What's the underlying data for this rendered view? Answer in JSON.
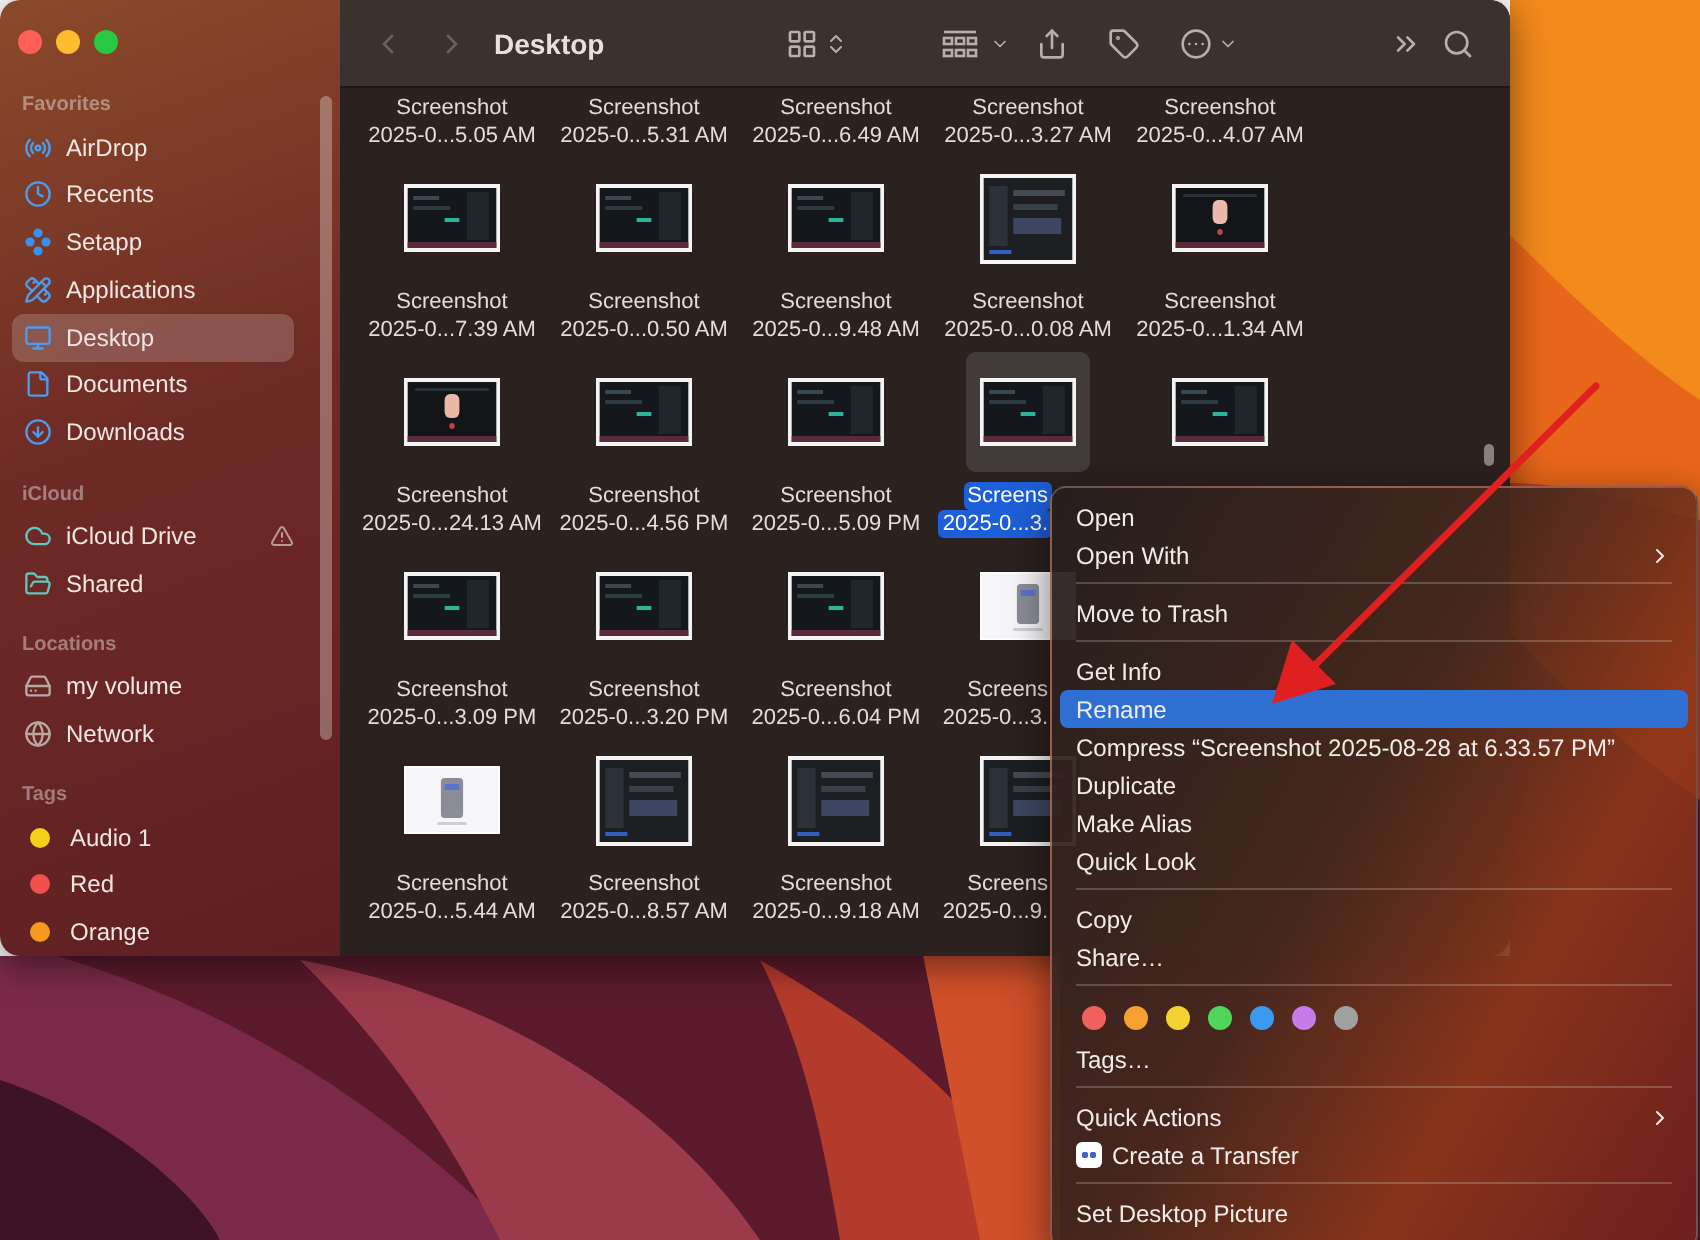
{
  "window": {
    "title": "Desktop"
  },
  "toolbar": {
    "back": {
      "disabled": true
    },
    "forward": {
      "disabled": true
    }
  },
  "sidebar": {
    "sections": [
      {
        "header": "Favorites",
        "items": [
          {
            "label": "AirDrop",
            "kind": "airdrop",
            "selected": false
          },
          {
            "label": "Recents",
            "kind": "clock",
            "selected": false
          },
          {
            "label": "Setapp",
            "kind": "setapp",
            "selected": false
          },
          {
            "label": "Applications",
            "kind": "apps",
            "selected": false
          },
          {
            "label": "Desktop",
            "kind": "desktop",
            "selected": true
          },
          {
            "label": "Documents",
            "kind": "document",
            "selected": false
          },
          {
            "label": "Downloads",
            "kind": "download",
            "selected": false
          }
        ]
      },
      {
        "header": "iCloud",
        "items": [
          {
            "label": "iCloud Drive",
            "kind": "cloud",
            "selected": false,
            "warning": true
          },
          {
            "label": "Shared",
            "kind": "shared",
            "selected": false,
            "warning": false
          }
        ]
      },
      {
        "header": "Locations",
        "items": [
          {
            "label": "my volume",
            "kind": "drive",
            "selected": false
          },
          {
            "label": "Network",
            "kind": "network",
            "selected": false
          }
        ]
      },
      {
        "header": "Tags",
        "items": [
          {
            "label": "Audio 1",
            "kind": "tag",
            "color": "#f5cf1a",
            "selected": false
          },
          {
            "label": "Red",
            "kind": "tag",
            "color": "#f0504c",
            "selected": false
          },
          {
            "label": "Orange",
            "kind": "tag",
            "color": "#f59a1e",
            "selected": false
          }
        ]
      }
    ]
  },
  "files": {
    "rows": [
      {
        "items": [
          {
            "label": [
              "Screenshot",
              "2025-0...5.05 AM"
            ],
            "selected": false
          },
          {
            "label": [
              "Screenshot",
              "2025-0...5.31 AM"
            ],
            "selected": false
          },
          {
            "label": [
              "Screenshot",
              "2025-0...6.49 AM"
            ],
            "selected": false
          },
          {
            "label": [
              "Screenshot",
              "2025-0...3.27 AM"
            ],
            "selected": false
          },
          {
            "label": [
              "Screenshot",
              "2025-0...4.07 AM"
            ],
            "selected": false
          }
        ]
      },
      {
        "items": [
          {
            "kind": "dark",
            "label": [
              "Screenshot",
              "2025-0...7.39 AM"
            ],
            "selected": false
          },
          {
            "kind": "dark",
            "label": [
              "Screenshot",
              "2025-0...0.50 AM"
            ],
            "selected": false
          },
          {
            "kind": "dark",
            "label": [
              "Screenshot",
              "2025-0...9.48 AM"
            ],
            "selected": false
          },
          {
            "kind": "tall",
            "label": [
              "Screenshot",
              "2025-0...0.08 AM"
            ],
            "selected": false
          },
          {
            "kind": "figure",
            "label": [
              "Screenshot",
              "2025-0...1.34 AM"
            ],
            "selected": false
          }
        ]
      },
      {
        "items": [
          {
            "kind": "figure",
            "label": [
              "Screenshot",
              "2025-0...24.13 AM"
            ],
            "selected": false
          },
          {
            "kind": "dark",
            "label": [
              "Screenshot",
              "2025-0...4.56 PM"
            ],
            "selected": false
          },
          {
            "kind": "dark",
            "label": [
              "Screenshot",
              "2025-0...5.09 PM"
            ],
            "selected": false
          },
          {
            "kind": "dark",
            "label": [
              "Screens",
              "2025-0...3."
            ],
            "selected": true
          },
          {
            "kind": "dark",
            "selected": false
          }
        ]
      },
      {
        "items": [
          {
            "kind": "dark",
            "label": [
              "Screenshot",
              "2025-0...3.09 PM"
            ],
            "selected": false
          },
          {
            "kind": "dark",
            "label": [
              "Screenshot",
              "2025-0...3.20 PM"
            ],
            "selected": false
          },
          {
            "kind": "dark",
            "label": [
              "Screenshot",
              "2025-0...6.04 PM"
            ],
            "selected": false
          },
          {
            "kind": "light",
            "label": [
              "Screens",
              "2025-0...3."
            ],
            "selected": false
          }
        ]
      },
      {
        "items": [
          {
            "kind": "light",
            "label": [
              "Screenshot",
              "2025-0...5.44 AM"
            ],
            "selected": false
          },
          {
            "kind": "tall",
            "label": [
              "Screenshot",
              "2025-0...8.57 AM"
            ],
            "selected": false
          },
          {
            "kind": "tall",
            "label": [
              "Screenshot",
              "2025-0...9.18 AM"
            ],
            "selected": false
          },
          {
            "kind": "tall",
            "label": [
              "Screens",
              "2025-0...9."
            ],
            "selected": false
          }
        ]
      }
    ]
  },
  "menu": {
    "items": [
      {
        "kind": "item",
        "label": "Open",
        "selected": false,
        "submenu": false
      },
      {
        "kind": "item",
        "label": "Open With",
        "selected": false,
        "submenu": true
      },
      {
        "kind": "separator"
      },
      {
        "kind": "item",
        "label": "Move to Trash",
        "selected": false,
        "submenu": false
      },
      {
        "kind": "separator"
      },
      {
        "kind": "item",
        "label": "Get Info",
        "selected": false,
        "submenu": false
      },
      {
        "kind": "item",
        "label": "Rename",
        "selected": true,
        "submenu": false
      },
      {
        "kind": "item",
        "label": "Compress “Screenshot 2025-08-28 at 6.33.57 PM”",
        "selected": false,
        "submenu": false
      },
      {
        "kind": "item",
        "label": "Duplicate",
        "selected": false,
        "submenu": false
      },
      {
        "kind": "item",
        "label": "Make Alias",
        "selected": false,
        "submenu": false
      },
      {
        "kind": "item",
        "label": "Quick Look",
        "selected": false,
        "submenu": false
      },
      {
        "kind": "separator"
      },
      {
        "kind": "item",
        "label": "Copy",
        "selected": false,
        "submenu": false
      },
      {
        "kind": "item",
        "label": "Share…",
        "selected": false,
        "submenu": false
      },
      {
        "kind": "separator"
      },
      {
        "kind": "tags",
        "dots": [
          {
            "color": "#f0605c"
          },
          {
            "color": "#f5a030"
          },
          {
            "color": "#f5d130"
          },
          {
            "color": "#4fd65a"
          },
          {
            "color": "#3b9af0"
          },
          {
            "color": "#c77ae8"
          },
          {
            "color": "#a0a0a0"
          }
        ]
      },
      {
        "kind": "item",
        "label": "Tags…",
        "selected": false,
        "submenu": false
      },
      {
        "kind": "separator"
      },
      {
        "kind": "item",
        "label": "Quick Actions",
        "selected": false,
        "submenu": true
      },
      {
        "kind": "app_item",
        "label": "Create a Transfer",
        "selected": false,
        "submenu": false
      },
      {
        "kind": "separator"
      },
      {
        "kind": "item",
        "label": "Set Desktop Picture",
        "selected": false,
        "submenu": false
      }
    ]
  }
}
